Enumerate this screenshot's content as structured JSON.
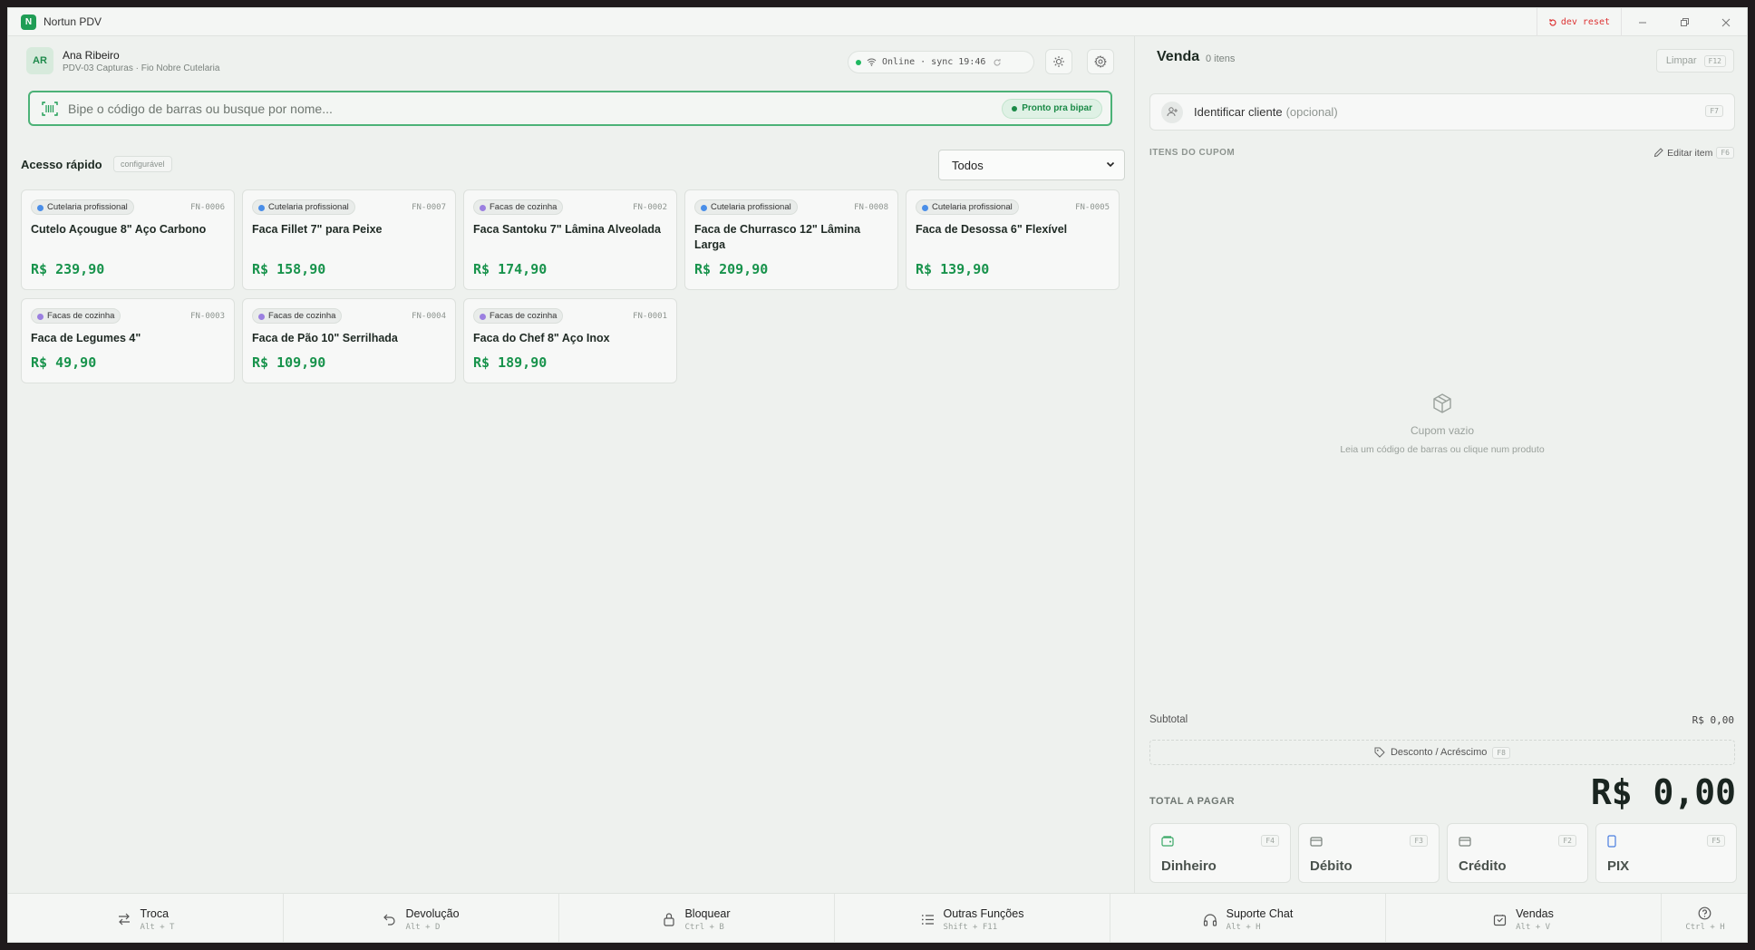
{
  "app": {
    "logo_letter": "N",
    "title": "Nortun PDV",
    "dev_reset": "dev reset"
  },
  "user": {
    "initials": "AR",
    "name": "Ana Ribeiro",
    "subtitle": "PDV-03 Capturas · Fio Nobre Cutelaria"
  },
  "status": {
    "text": "Online · sync 19:46",
    "color": "#1fb860"
  },
  "search": {
    "placeholder": "Bipe o código de barras ou busque por nome...",
    "value": "",
    "badge": "Pronto pra bipar"
  },
  "quick_access": {
    "title": "Acesso rápido",
    "tag": "configurável",
    "filter": {
      "selected": "Todos"
    },
    "products": [
      {
        "category": "Cutelaria profissional",
        "code": "FN-0006",
        "name": "Cutelo Açougue 8\" Aço Carbono",
        "price": "R$ 239,90"
      },
      {
        "category": "Cutelaria profissional",
        "code": "FN-0007",
        "name": "Faca Fillet 7\" para Peixe",
        "price": "R$ 158,90"
      },
      {
        "category": "Facas de cozinha",
        "code": "FN-0002",
        "name": "Faca Santoku 7\" Lâmina Alveolada",
        "price": "R$ 174,90"
      },
      {
        "category": "Cutelaria profissional",
        "code": "FN-0008",
        "name": "Faca de Churrasco 12\" Lâmina Larga",
        "price": "R$ 209,90"
      },
      {
        "category": "Cutelaria profissional",
        "code": "FN-0005",
        "name": "Faca de Desossa 6\" Flexível",
        "price": "R$ 139,90"
      },
      {
        "category": "Facas de cozinha",
        "code": "FN-0003",
        "name": "Faca de Legumes 4\"",
        "price": "R$ 49,90"
      },
      {
        "category": "Facas de cozinha",
        "code": "FN-0004",
        "name": "Faca de Pão 10\" Serrilhada",
        "price": "R$ 109,90"
      },
      {
        "category": "Facas de cozinha",
        "code": "FN-0001",
        "name": "Faca do Chef 8\" Aço Inox",
        "price": "R$ 189,90"
      }
    ],
    "category_colors": {
      "Cutelaria profissional": "#4a8ee8",
      "Facas de cozinha": "#9b7fe0"
    }
  },
  "sale": {
    "title": "Venda",
    "count": "0 itens",
    "clear_label": "Limpar",
    "clear_key": "F12",
    "client_label": "Identificar cliente",
    "client_optional": "(opcional)",
    "client_key": "F7",
    "items_label": "ITENS DO CUPOM",
    "edit_label": "Editar item",
    "edit_key": "F6",
    "empty_title": "Cupom vazio",
    "empty_sub": "Leia um código de barras ou clique num produto",
    "subtotal_label": "Subtotal",
    "subtotal_value": "R$ 0,00",
    "discount_label": "Desconto / Acréscimo",
    "discount_key": "F8",
    "total_label": "TOTAL A PAGAR",
    "total_value": "R$ 0,00",
    "payments": [
      {
        "label": "Dinheiro",
        "key": "F4",
        "icon": "cash-icon",
        "color": "#3aa866"
      },
      {
        "label": "Débito",
        "key": "F3",
        "icon": "card-icon",
        "color": "#7a827d"
      },
      {
        "label": "Crédito",
        "key": "F2",
        "icon": "card-icon",
        "color": "#7a827d"
      },
      {
        "label": "PIX",
        "key": "F5",
        "icon": "phone-icon",
        "color": "#4a7ee0"
      }
    ]
  },
  "bottom_bar": [
    {
      "label": "Troca",
      "key": "Alt + T",
      "icon": "swap-icon"
    },
    {
      "label": "Devolução",
      "key": "Alt + D",
      "icon": "undo-icon"
    },
    {
      "label": "Bloquear",
      "key": "Ctrl + B",
      "icon": "lock-icon"
    },
    {
      "label": "Outras Funções",
      "key": "Shift + F11",
      "icon": "list-icon"
    },
    {
      "label": "Suporte Chat",
      "key": "Alt + H",
      "icon": "headset-icon"
    },
    {
      "label": "Vendas",
      "key": "Alt + V",
      "icon": "cart-icon"
    },
    {
      "label": "",
      "key": "Ctrl + H",
      "icon": "help-icon"
    }
  ]
}
